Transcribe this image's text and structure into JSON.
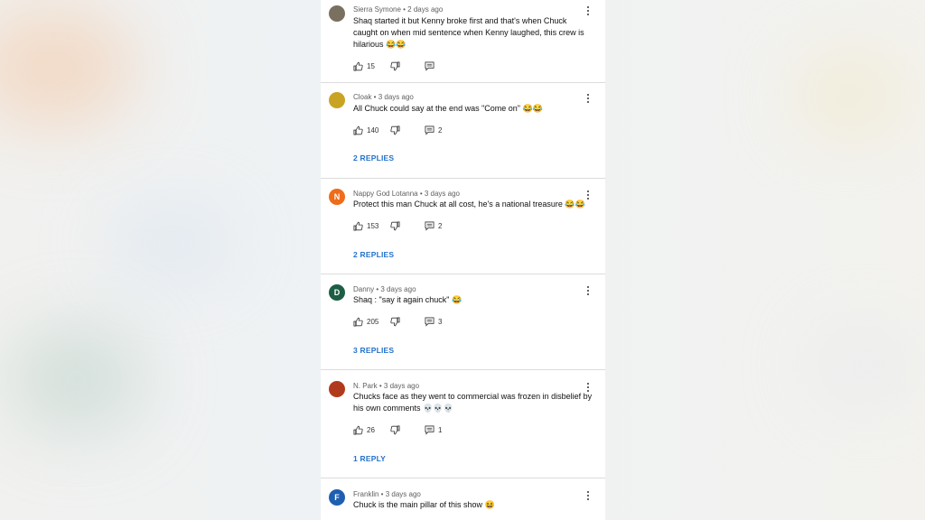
{
  "comments": [
    {
      "author": "Sierra Symone",
      "time": "2 days ago",
      "text": "Shaq started it but Kenny broke first and that's when Chuck caught on when mid sentence when Kenny laughed, this crew is hilarious 😂😂",
      "likes": "15",
      "reply_count": "",
      "replies_label": "",
      "avatar_letter": "",
      "avatar_color": "#7a7060"
    },
    {
      "author": "Cloak",
      "time": "3 days ago",
      "text": "All Chuck could say at the end was \"Come on\" 😂😂",
      "likes": "140",
      "reply_count": "2",
      "replies_label": "2 REPLIES",
      "avatar_letter": "",
      "avatar_color": "#c9a324"
    },
    {
      "author": "Nappy God Lotanna",
      "time": "3 days ago",
      "text": "Protect this man Chuck at all cost, he's a national treasure 😂😂",
      "likes": "153",
      "reply_count": "2",
      "replies_label": "2 REPLIES",
      "avatar_letter": "N",
      "avatar_color": "#ef6c1a"
    },
    {
      "author": "Danny",
      "time": "3 days ago",
      "text": "Shaq : \"say it again chuck\" 😂",
      "likes": "205",
      "reply_count": "3",
      "replies_label": "3 REPLIES",
      "avatar_letter": "D",
      "avatar_color": "#1d5e45"
    },
    {
      "author": "N. Park",
      "time": "3 days ago",
      "text": "Chucks face as they went to commercial was frozen in disbelief by his own comments 💀💀💀",
      "likes": "26",
      "reply_count": "1",
      "replies_label": "1 REPLY",
      "avatar_letter": "",
      "avatar_color": "#b23a1c"
    },
    {
      "author": "Franklin",
      "time": "3 days ago",
      "text": "Chuck is the main pillar of this show 😆",
      "likes": "",
      "reply_count": "",
      "replies_label": "",
      "avatar_letter": "F",
      "avatar_color": "#1f5fb0"
    }
  ],
  "icons": {
    "like": "thumbs-up-icon",
    "dislike": "thumbs-down-icon",
    "reply": "reply-icon",
    "more": "more-vert-icon"
  }
}
